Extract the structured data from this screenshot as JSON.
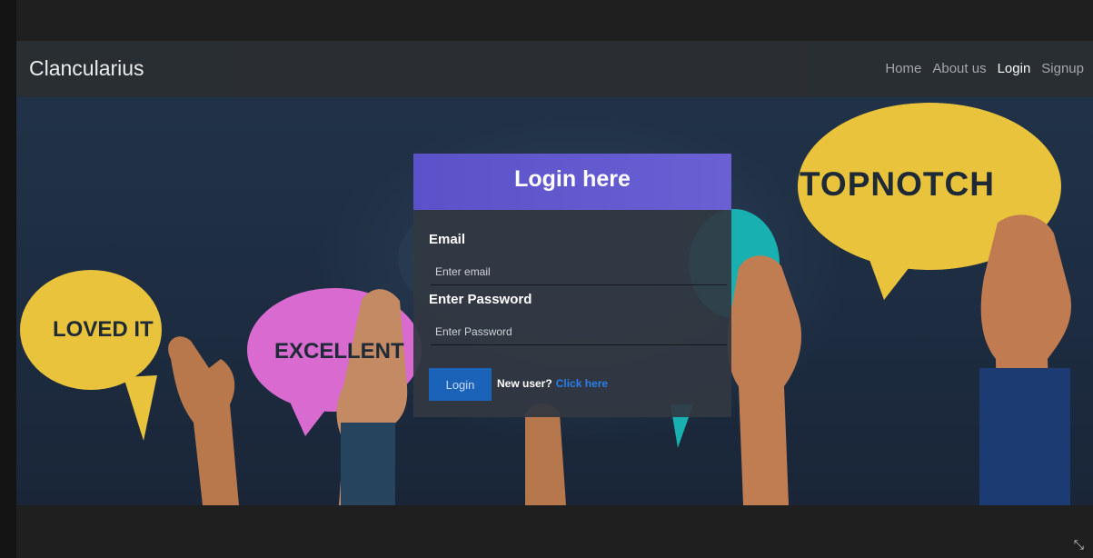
{
  "navbar": {
    "brand": "Clancularius",
    "links": [
      {
        "label": "Home"
      },
      {
        "label": "About us"
      },
      {
        "label": "Login"
      },
      {
        "label": "Signup"
      }
    ]
  },
  "bubbles": {
    "left": "LOVED IT",
    "pink": "EXCELLENT",
    "right": "TOPNOTCH"
  },
  "login": {
    "title": "Login here",
    "email_label": "Email",
    "email_placeholder": "Enter email",
    "password_label": "Enter Password",
    "password_placeholder": "Enter Password",
    "submit_label": "Login",
    "new_user_text": "New user?",
    "signup_link": "Click here"
  },
  "colors": {
    "accent": "#5b52c9",
    "button": "#1a63b8",
    "link": "#2b7de9",
    "yellow_bubble": "#e9c33c",
    "pink_bubble": "#d86ad0",
    "teal_bubble": "#18b0b0"
  },
  "icons": {
    "corner": "minimize-icon"
  }
}
